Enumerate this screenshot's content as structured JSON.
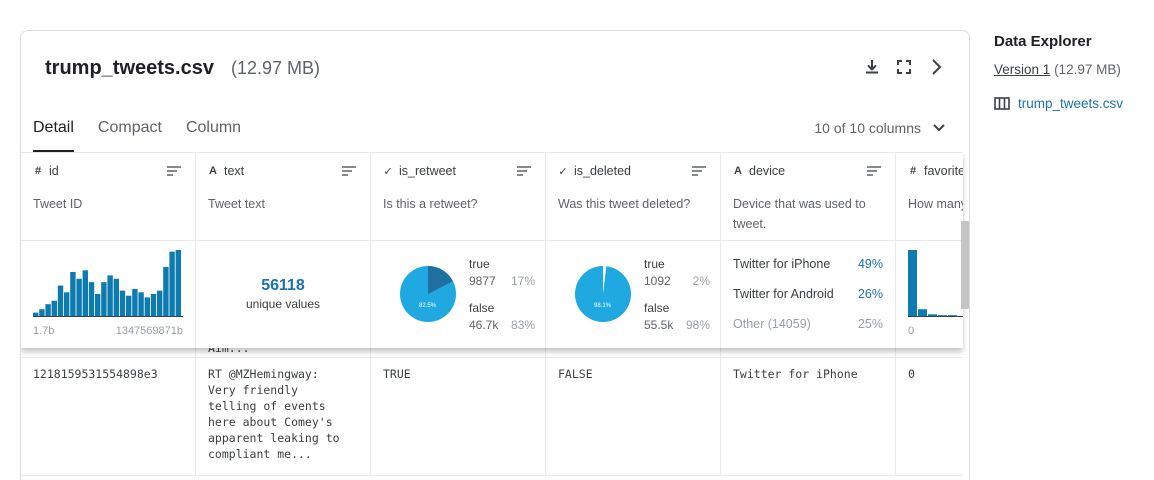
{
  "header": {
    "file_name": "trump_tweets.csv",
    "file_size": "(12.97 MB)",
    "icons": [
      "download-icon",
      "fullscreen-icon",
      "chevron-right-icon"
    ]
  },
  "tabs": [
    {
      "label": "Detail",
      "active": true
    },
    {
      "label": "Compact",
      "active": false
    },
    {
      "label": "Column",
      "active": false
    }
  ],
  "column_count": "10 of 10 columns",
  "columns": [
    {
      "type": "#",
      "name": "id",
      "desc": "Tweet ID"
    },
    {
      "type": "A",
      "name": "text",
      "desc": "Tweet text"
    },
    {
      "type": "✓",
      "name": "is_retweet",
      "desc": "Is this a retweet?"
    },
    {
      "type": "✓",
      "name": "is_deleted",
      "desc": "Was this tweet deleted?"
    },
    {
      "type": "A",
      "name": "device",
      "desc": "Device that was used to tweet."
    },
    {
      "type": "#",
      "name": "favorites",
      "desc": "How many favorites"
    }
  ],
  "id_stats": {
    "histogram": [
      2,
      4,
      7,
      9,
      18,
      14,
      26,
      22,
      27,
      20,
      13,
      20,
      24,
      22,
      15,
      12,
      16,
      14,
      11,
      13,
      15,
      29,
      38,
      39
    ],
    "min_label": "1.7b",
    "max_label": "1347569871b"
  },
  "text_stats": {
    "unique_count": "56118",
    "unique_label": "unique values"
  },
  "is_retweet_stats": {
    "pie_label": "82.5%",
    "true_label": "true",
    "true_count": "9877",
    "true_pct": "17%",
    "false_label": "false",
    "false_count": "46.7k",
    "false_pct": "83%",
    "true_fraction": 0.175
  },
  "is_deleted_stats": {
    "pie_label": "98.1%",
    "true_label": "true",
    "true_count": "1092",
    "true_pct": "2%",
    "false_label": "false",
    "false_count": "55.5k",
    "false_pct": "98%",
    "true_fraction": 0.019
  },
  "device_stats": [
    {
      "name": "Twitter for iPhone",
      "pct": "49%"
    },
    {
      "name": "Twitter for Android",
      "pct": "26%"
    },
    {
      "name": "Other (14059)",
      "pct": "25%"
    }
  ],
  "favorites_stats": {
    "histogram": [
      39,
      4,
      1,
      0.5,
      0.5
    ],
    "min_label": "0"
  },
  "rows": [
    {
      "id": "",
      "text": "Aim...",
      "is_retweet": "",
      "is_deleted": "",
      "device": "",
      "favorites": ""
    },
    {
      "id": "1218159531554898e3",
      "text": "RT @MZHemingway:\nVery friendly\ntelling of events\nhere about Comey's\napparent leaking to\ncompliant me...",
      "is_retweet": "TRUE",
      "is_deleted": "FALSE",
      "device": "Twitter for iPhone",
      "favorites": "0"
    }
  ],
  "sidebar": {
    "title": "Data Explorer",
    "version": "Version 1",
    "version_size": "(12.97 MB)",
    "file": "trump_tweets.csv"
  },
  "colors": {
    "accent": "#1a73b0",
    "bar": "#0d7ab0",
    "pie_main": "#20a9e0",
    "pie_minor": "#1f6fa0"
  }
}
